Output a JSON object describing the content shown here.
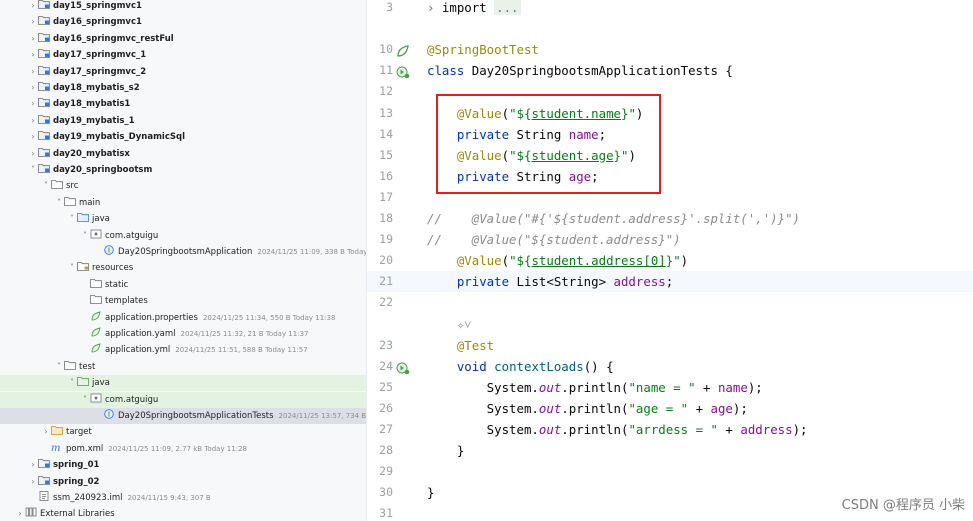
{
  "project_tree": {
    "rows": [
      {
        "chev": ">",
        "icon": "module-folder-icon",
        "label": "day15_springmvc1",
        "bold": true
      },
      {
        "chev": ">",
        "icon": "module-folder-icon",
        "label": "day16_springmvc1",
        "bold": true
      },
      {
        "chev": ">",
        "icon": "module-folder-icon",
        "label": "day16_springmvc_restFul",
        "bold": true
      },
      {
        "chev": ">",
        "icon": "module-folder-icon",
        "label": "day17_springmvc_1",
        "bold": true
      },
      {
        "chev": ">",
        "icon": "module-folder-icon",
        "label": "day17_springmvc_2",
        "bold": true
      },
      {
        "chev": ">",
        "icon": "module-folder-icon",
        "label": "day18_mybatis_s2",
        "bold": true
      },
      {
        "chev": ">",
        "icon": "module-folder-icon",
        "label": "day18_mybatis1",
        "bold": true
      },
      {
        "chev": ">",
        "icon": "module-folder-icon",
        "label": "day19_mybatis_1",
        "bold": true
      },
      {
        "chev": ">",
        "icon": "module-folder-icon",
        "label": "day19_mybatis_DynamicSql",
        "bold": true
      },
      {
        "chev": ">",
        "icon": "module-folder-icon",
        "label": "day20_mybatisx",
        "bold": true
      },
      {
        "chev": "v",
        "icon": "module-folder-icon",
        "label": "day20_springbootsm",
        "bold": true
      },
      {
        "chev": "v",
        "icon": "folder-icon",
        "label": "src",
        "bold": false
      },
      {
        "chev": "v",
        "icon": "folder-icon",
        "label": "main",
        "bold": false
      },
      {
        "chev": "v",
        "icon": "source-folder-icon",
        "label": "java",
        "bold": false
      },
      {
        "chev": "v",
        "icon": "package-icon",
        "label": "com.atguigu",
        "bold": false
      },
      {
        "chev": "",
        "icon": "spring-class-icon",
        "label": "Day20SpringbootsmApplication",
        "bold": false,
        "meta": "2024/11/25 11:09, 338 B Today 11"
      },
      {
        "chev": "v",
        "icon": "resources-folder-icon",
        "label": "resources",
        "bold": false
      },
      {
        "chev": "",
        "icon": "folder-icon",
        "label": "static",
        "bold": false
      },
      {
        "chev": "",
        "icon": "folder-icon",
        "label": "templates",
        "bold": false
      },
      {
        "chev": "",
        "icon": "properties-file-icon",
        "label": "application.properties",
        "bold": false,
        "meta": "2024/11/25 11:34, 550 B Today 11:38"
      },
      {
        "chev": "",
        "icon": "yaml-file-icon",
        "label": "application.yaml",
        "bold": false,
        "meta": "2024/11/25 11:32, 21 B Today 11:37"
      },
      {
        "chev": "",
        "icon": "yaml-file-icon",
        "label": "application.yml",
        "bold": false,
        "meta": "2024/11/25 11:51, 588 B Today 11:57"
      },
      {
        "chev": "v",
        "icon": "folder-icon",
        "label": "test",
        "bold": false
      },
      {
        "chev": "v",
        "icon": "test-folder-icon",
        "label": "java",
        "bold": false
      },
      {
        "chev": "v",
        "icon": "package-icon",
        "label": "com.atguigu",
        "bold": false
      },
      {
        "chev": "",
        "icon": "spring-class-icon",
        "label": "Day20SpringbootsmApplicationTests",
        "bold": false,
        "meta": "2024/11/25 13:57, 734 B A"
      },
      {
        "chev": ">",
        "icon": "excluded-folder-icon",
        "label": "target",
        "bold": false
      },
      {
        "chev": "",
        "icon": "maven-file-icon",
        "label": "pom.xml",
        "bold": false,
        "meta": "2024/11/25 11:09, 2.77 kB Today 11:28"
      },
      {
        "chev": ">",
        "icon": "module-folder-icon",
        "label": "spring_01",
        "bold": true
      },
      {
        "chev": ">",
        "icon": "module-folder-icon",
        "label": "spring_02",
        "bold": true
      },
      {
        "chev": "",
        "icon": "iml-file-icon",
        "label": "ssm_240923.iml",
        "bold": false,
        "meta": "2024/11/15 9:43, 307 B"
      },
      {
        "chev": ">",
        "icon": "library-icon",
        "label": "External Libraries",
        "bold": false
      }
    ]
  },
  "editor": {
    "lines": [
      {
        "num": "3",
        "parts": [
          [
            "fold",
            "› "
          ],
          [
            "plain",
            "import "
          ],
          [
            "dots",
            "..."
          ]
        ]
      },
      {
        "num": "",
        "parts": []
      },
      {
        "num": "10",
        "gutter": "spring-bean-icon",
        "parts": [
          [
            "ann",
            "@SpringBootTest"
          ]
        ]
      },
      {
        "num": "11",
        "gutter": "run-test-icon",
        "parts": [
          [
            "kw",
            "class "
          ],
          [
            "plain",
            "Day20SpringbootsmApplicationTests {"
          ]
        ]
      },
      {
        "num": "12",
        "parts": []
      },
      {
        "num": "13",
        "parts": [
          [
            "plain",
            "    "
          ],
          [
            "ann",
            "@Value"
          ],
          [
            "plain",
            "("
          ],
          [
            "str",
            "\"${"
          ],
          [
            "str_ul",
            "student.name"
          ],
          [
            "str",
            "}\""
          ],
          [
            "plain",
            ")"
          ]
        ]
      },
      {
        "num": "14",
        "parts": [
          [
            "plain",
            "    "
          ],
          [
            "kw",
            "private "
          ],
          [
            "plain",
            "String "
          ],
          [
            "field",
            "name"
          ],
          [
            "plain",
            ";"
          ]
        ]
      },
      {
        "num": "15",
        "parts": [
          [
            "plain",
            "    "
          ],
          [
            "ann",
            "@Value"
          ],
          [
            "plain",
            "("
          ],
          [
            "str",
            "\"${"
          ],
          [
            "str_ul",
            "student.age"
          ],
          [
            "str",
            "}\""
          ],
          [
            "plain",
            ")"
          ]
        ]
      },
      {
        "num": "16",
        "parts": [
          [
            "plain",
            "    "
          ],
          [
            "kw",
            "private "
          ],
          [
            "plain",
            "String "
          ],
          [
            "field",
            "age"
          ],
          [
            "plain",
            ";"
          ]
        ]
      },
      {
        "num": "17",
        "parts": []
      },
      {
        "num": "18",
        "parts": [
          [
            "cmt",
            "//    @Value(\"#{'${student.address}'.split(',')}\")"
          ]
        ]
      },
      {
        "num": "19",
        "parts": [
          [
            "cmt",
            "//    @Value(\"${student.address}\")"
          ]
        ]
      },
      {
        "num": "20",
        "parts": [
          [
            "plain",
            "    "
          ],
          [
            "ann",
            "@Value"
          ],
          [
            "plain",
            "("
          ],
          [
            "str",
            "\"${"
          ],
          [
            "str_ul",
            "student.address[0]"
          ],
          [
            "str",
            "}\""
          ],
          [
            "plain",
            ")"
          ]
        ]
      },
      {
        "num": "21",
        "current": true,
        "parts": [
          [
            "plain",
            "    "
          ],
          [
            "kw",
            "private "
          ],
          [
            "plain",
            "List<String> "
          ],
          [
            "field",
            "address"
          ],
          [
            "plain",
            ";"
          ]
        ]
      },
      {
        "num": "22",
        "parts": []
      },
      {
        "num": "",
        "parts": [
          [
            "plain",
            "    "
          ],
          [
            "fold",
            "✧˅"
          ]
        ]
      },
      {
        "num": "23",
        "parts": [
          [
            "plain",
            "    "
          ],
          [
            "ann",
            "@Test"
          ]
        ]
      },
      {
        "num": "24",
        "gutter": "run-test-icon",
        "parts": [
          [
            "plain",
            "    "
          ],
          [
            "kw",
            "void "
          ],
          [
            "mth",
            "contextLoads"
          ],
          [
            "plain",
            "() {"
          ]
        ]
      },
      {
        "num": "25",
        "parts": [
          [
            "plain",
            "        System."
          ],
          [
            "stat",
            "out"
          ],
          [
            "plain",
            ".println("
          ],
          [
            "str",
            "\"name = \""
          ],
          [
            "plain",
            " + "
          ],
          [
            "field",
            "name"
          ],
          [
            "plain",
            ");"
          ]
        ]
      },
      {
        "num": "26",
        "parts": [
          [
            "plain",
            "        System."
          ],
          [
            "stat",
            "out"
          ],
          [
            "plain",
            ".println("
          ],
          [
            "str",
            "\"age = \""
          ],
          [
            "plain",
            " + "
          ],
          [
            "field",
            "age"
          ],
          [
            "plain",
            ");"
          ]
        ]
      },
      {
        "num": "27",
        "parts": [
          [
            "plain",
            "        System."
          ],
          [
            "stat",
            "out"
          ],
          [
            "plain",
            ".println("
          ],
          [
            "str",
            "\"arrdess = \""
          ],
          [
            "plain",
            " + "
          ],
          [
            "field",
            "address"
          ],
          [
            "plain",
            ");"
          ]
        ]
      },
      {
        "num": "28",
        "parts": [
          [
            "plain",
            "    }"
          ]
        ]
      },
      {
        "num": "29",
        "parts": []
      },
      {
        "num": "30",
        "parts": [
          [
            "plain",
            "}"
          ]
        ]
      },
      {
        "num": "31",
        "parts": []
      }
    ]
  },
  "watermark": "CSDN @程序员 小柴",
  "colors": {
    "highlight_box": "#e02020",
    "keyword": "#0033b3",
    "annotation": "#9e880d",
    "string": "#067d17",
    "field": "#871094"
  }
}
